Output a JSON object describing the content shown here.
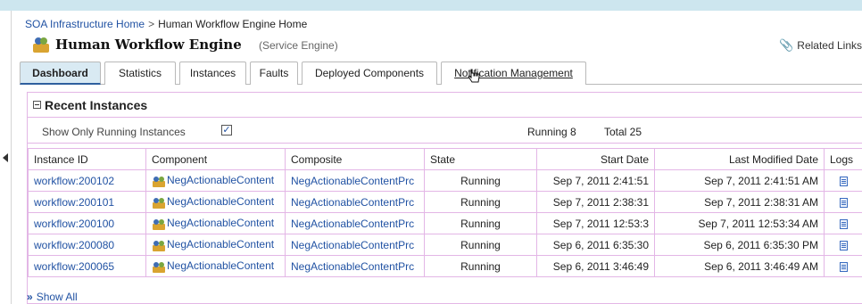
{
  "breadcrumb": {
    "home_link": "SOA Infrastructure Home",
    "separator": ">",
    "current": "Human Workflow Engine Home"
  },
  "header": {
    "title": "Human Workflow Engine",
    "subtitle": "(Service Engine)",
    "related_links": "Related Links"
  },
  "tabs": [
    {
      "label": "Dashboard",
      "active": true
    },
    {
      "label": "Statistics"
    },
    {
      "label": "Instances"
    },
    {
      "label": "Faults"
    },
    {
      "label": "Deployed Components"
    },
    {
      "label": "Notification Management"
    }
  ],
  "recent_instances": {
    "title": "Recent Instances",
    "filter_label": "Show Only Running Instances",
    "filter_checked": true,
    "running": "Running 8",
    "total": "Total 25",
    "columns": [
      "Instance ID",
      "Component",
      "Composite",
      "State",
      "Start Date",
      "Last Modified Date",
      "Logs"
    ],
    "rows": [
      {
        "id": "workflow:200102",
        "component": "NegActionableContent",
        "composite": "NegActionableContentPrc",
        "state": "Running",
        "start": "Sep 7, 2011 2:41:51",
        "modified": "Sep 7, 2011 2:41:51 AM"
      },
      {
        "id": "workflow:200101",
        "component": "NegActionableContent",
        "composite": "NegActionableContentPrc",
        "state": "Running",
        "start": "Sep 7, 2011 2:38:31",
        "modified": "Sep 7, 2011 2:38:31 AM"
      },
      {
        "id": "workflow:200100",
        "component": "NegActionableContent",
        "composite": "NegActionableContentPrc",
        "state": "Running",
        "start": "Sep 7, 2011 12:53:3",
        "modified": "Sep 7, 2011 12:53:34 AM"
      },
      {
        "id": "workflow:200080",
        "component": "NegActionableContent",
        "composite": "NegActionableContentPrc",
        "state": "Running",
        "start": "Sep 6, 2011 6:35:30",
        "modified": "Sep 6, 2011 6:35:30 PM"
      },
      {
        "id": "workflow:200065",
        "component": "NegActionableContent",
        "composite": "NegActionableContentPrc",
        "state": "Running",
        "start": "Sep 6, 2011 3:46:49",
        "modified": "Sep 6, 2011 3:46:49 AM"
      }
    ],
    "show_all": "Show All"
  },
  "colors": {
    "link": "#2152a3",
    "active_tab_bg": "#d9eaf3",
    "table_border": "#e3b6e6",
    "top_band": "#cde6ef"
  },
  "icons": {
    "engine": "people-engine-icon",
    "related": "paperclip-icon",
    "component": "component-people-icon",
    "log": "log-document-icon",
    "show_all": "double-chevron-icon",
    "collapse": "collapse-left-icon"
  }
}
